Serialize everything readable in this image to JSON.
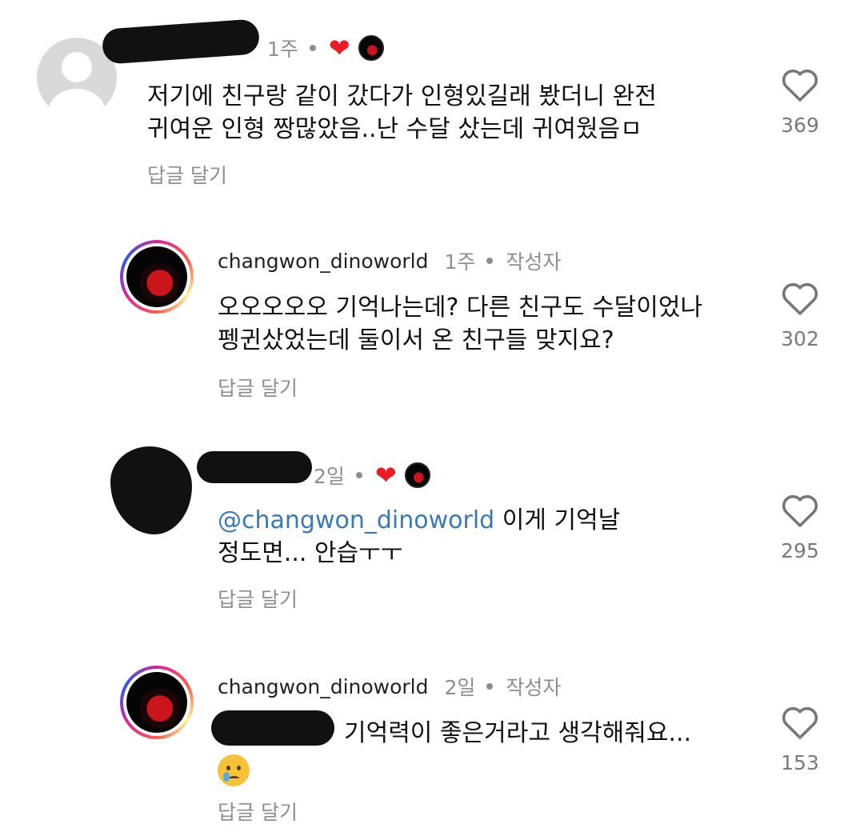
{
  "comments": [
    {
      "time": "1주",
      "text_line1": "저기에 친구랑 같이 갔다가 인형있길래 봤더니 완전",
      "text_line2": "귀여운 인형 짱많았음..난 수달 샀는데 귀여웠음ㅁ",
      "reply_label": "답글 달기",
      "likes": "369",
      "creator_liked": true
    },
    {
      "username": "changwon_dinoworld",
      "time": "1주",
      "author_badge": "작성자",
      "text_line1": "오오오오오 기억나는데? 다른 친구도 수달이었나",
      "text_line2": "펭귄샀었는데 둘이서 온 친구들 맞지요?",
      "reply_label": "답글 달기",
      "likes": "302"
    },
    {
      "time": "2일",
      "mention": "@changwon_dinoworld",
      "text_line1_rest": " 이게 기억날",
      "text_line2": "정도면... 안습ㅜㅜ",
      "reply_label": "답글 달기",
      "likes": "295",
      "creator_liked": true
    },
    {
      "username": "changwon_dinoworld",
      "time": "2일",
      "author_badge": "작성자",
      "text_line1": "기억력이 좋은거라고 생각해줘요...",
      "reply_label": "답글 달기",
      "likes": "153",
      "emoji": "crying-face"
    }
  ],
  "colors": {
    "liked_heart": "#ed1c24",
    "mention": "#3a79b5",
    "secondary_text": "#8e8e8e"
  }
}
